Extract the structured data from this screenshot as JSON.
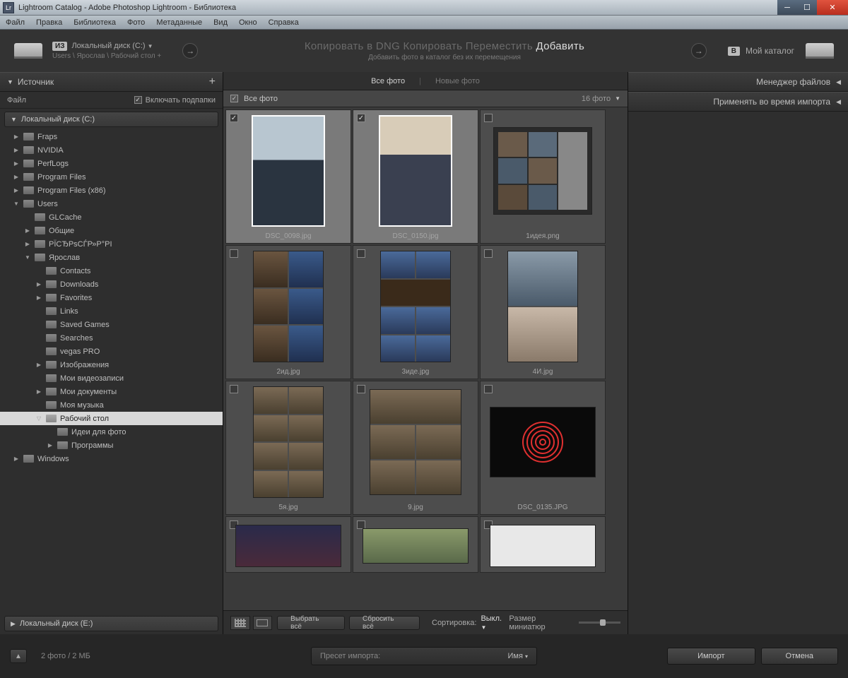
{
  "window": {
    "title": "Lightroom Catalog - Adobe Photoshop Lightroom - Библиотека",
    "lr_badge": "Lr"
  },
  "menu": [
    "Файл",
    "Правка",
    "Библиотека",
    "Фото",
    "Метаданные",
    "Вид",
    "Окно",
    "Справка"
  ],
  "top": {
    "from_badge": "ИЗ",
    "from_label": "Локальный диск (C:)",
    "from_path": "Users \\ Ярослав \\ Рабочий стол +",
    "options": {
      "copy_dng": "Копировать в DNG",
      "copy": "Копировать",
      "move": "Переместить",
      "add": "Добавить"
    },
    "subtitle": "Добавить фото в каталог без их перемещения",
    "to_badge": "В",
    "to_label": "Мой каталог"
  },
  "left": {
    "source": "Источник",
    "file_label": "Файл",
    "include_sub": "Включать подпапки",
    "drives": {
      "c": "Локальный диск (C:)",
      "e": "Локальный диск (E:)"
    },
    "tree": {
      "fraps": "Fraps",
      "nvidia": "NVIDIA",
      "perflogs": "PerfLogs",
      "pf": "Program Files",
      "pf86": "Program Files (x86)",
      "users": "Users",
      "glcache": "GLCache",
      "common": "Общие",
      "weird": "РЇСЂРѕСЃР»Р°РІ",
      "yaroslav": "Ярослав",
      "contacts": "Contacts",
      "downloads": "Downloads",
      "favorites": "Favorites",
      "links": "Links",
      "saved": "Saved Games",
      "searches": "Searches",
      "vegas": "vegas PRO",
      "images": "Изображения",
      "videos": "Мои видеозаписи",
      "docs": "Мои документы",
      "music": "Моя музыка",
      "desktop": "Рабочий стол",
      "ideas": "Идеи для фото",
      "programs": "Программы",
      "windows": "Windows"
    }
  },
  "center": {
    "tab_all": "Все фото",
    "tab_new": "Новые фото",
    "grid_title": "Все фото",
    "count": "16 фото",
    "files": [
      "DSC_0098.jpg",
      "DSC_0150.jpg",
      "1идея.png",
      "2ид.jpg",
      "3иде.jpg",
      "4И.jpg",
      "5я.jpg",
      "9.jpg",
      "DSC_0135.JPG",
      "",
      "",
      ""
    ],
    "toolbar": {
      "select_all": "Выбрать всё",
      "deselect_all": "Сбросить всё",
      "sort_label": "Сортировка:",
      "sort_value": "Выкл.",
      "thumb_label": "Размер миниатюр"
    }
  },
  "right": {
    "file_manager": "Менеджер файлов",
    "apply_import": "Применять во время импорта"
  },
  "bottom": {
    "status": "2 фото / 2 МБ",
    "preset_label": "Пресет импорта:",
    "preset_value": "Имя",
    "import": "Импорт",
    "cancel": "Отмена"
  }
}
